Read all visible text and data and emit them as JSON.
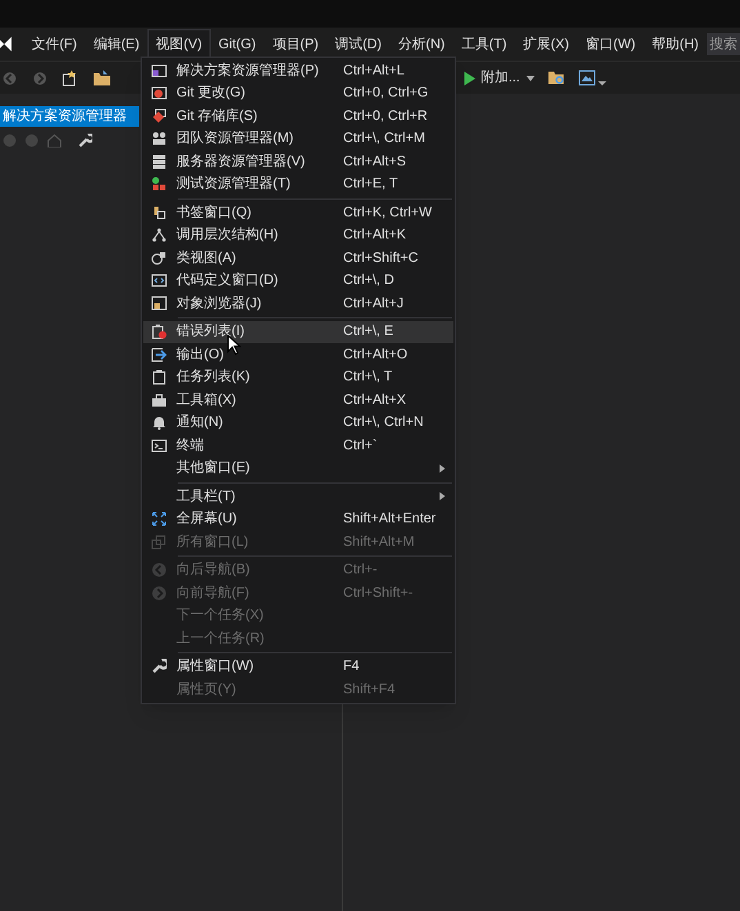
{
  "menu_bar": {
    "items": [
      {
        "label": "文件(F)",
        "selected": false
      },
      {
        "label": "编辑(E)",
        "selected": false
      },
      {
        "label": "视图(V)",
        "selected": true
      },
      {
        "label": "Git(G)",
        "selected": false
      },
      {
        "label": "项目(P)",
        "selected": false
      },
      {
        "label": "调试(D)",
        "selected": false
      },
      {
        "label": "分析(N)",
        "selected": false
      },
      {
        "label": "工具(T)",
        "selected": false
      },
      {
        "label": "扩展(X)",
        "selected": false
      },
      {
        "label": "窗口(W)",
        "selected": false
      },
      {
        "label": "帮助(H)",
        "selected": false
      }
    ],
    "search": {
      "placeholder": "搜索"
    }
  },
  "toolbar": {
    "attach_button": "附加..."
  },
  "side_panel": {
    "title": "解决方案资源管理器"
  },
  "view_menu": [
    {
      "kind": "item",
      "label": "解决方案资源管理器(P)",
      "shortcut": "Ctrl+Alt+L",
      "disabled": false,
      "selected": false
    },
    {
      "kind": "item",
      "label": "Git 更改(G)",
      "shortcut": "Ctrl+0, Ctrl+G",
      "disabled": false,
      "selected": false
    },
    {
      "kind": "item",
      "label": "Git 存储库(S)",
      "shortcut": "Ctrl+0, Ctrl+R",
      "disabled": false,
      "selected": false
    },
    {
      "kind": "item",
      "label": "团队资源管理器(M)",
      "shortcut": "Ctrl+\\, Ctrl+M",
      "disabled": false,
      "selected": false
    },
    {
      "kind": "item",
      "label": "服务器资源管理器(V)",
      "shortcut": "Ctrl+Alt+S",
      "disabled": false,
      "selected": false
    },
    {
      "kind": "item",
      "label": "测试资源管理器(T)",
      "shortcut": "Ctrl+E, T",
      "disabled": false,
      "selected": false
    },
    {
      "kind": "separator"
    },
    {
      "kind": "item",
      "label": "书签窗口(Q)",
      "shortcut": "Ctrl+K, Ctrl+W",
      "disabled": false,
      "selected": false
    },
    {
      "kind": "item",
      "label": "调用层次结构(H)",
      "shortcut": "Ctrl+Alt+K",
      "disabled": false,
      "selected": false
    },
    {
      "kind": "item",
      "label": "类视图(A)",
      "shortcut": "Ctrl+Shift+C",
      "disabled": false,
      "selected": false
    },
    {
      "kind": "item",
      "label": "代码定义窗口(D)",
      "shortcut": "Ctrl+\\, D",
      "disabled": false,
      "selected": false
    },
    {
      "kind": "item",
      "label": "对象浏览器(J)",
      "shortcut": "Ctrl+Alt+J",
      "disabled": false,
      "selected": false
    },
    {
      "kind": "separator"
    },
    {
      "kind": "item",
      "label": "错误列表(I)",
      "shortcut": "Ctrl+\\, E",
      "disabled": false,
      "selected": true
    },
    {
      "kind": "item",
      "label": "输出(O)",
      "shortcut": "Ctrl+Alt+O",
      "disabled": false,
      "selected": false
    },
    {
      "kind": "item",
      "label": "任务列表(K)",
      "shortcut": "Ctrl+\\, T",
      "disabled": false,
      "selected": false
    },
    {
      "kind": "item",
      "label": "工具箱(X)",
      "shortcut": "Ctrl+Alt+X",
      "disabled": false,
      "selected": false
    },
    {
      "kind": "item",
      "label": "通知(N)",
      "shortcut": "Ctrl+\\, Ctrl+N",
      "disabled": false,
      "selected": false
    },
    {
      "kind": "item",
      "label": "终端",
      "shortcut": "Ctrl+`",
      "disabled": false,
      "selected": false
    },
    {
      "kind": "submenu",
      "label": "其他窗口(E)",
      "disabled": false,
      "selected": false
    },
    {
      "kind": "separator"
    },
    {
      "kind": "submenu",
      "label": "工具栏(T)",
      "disabled": false,
      "selected": false
    },
    {
      "kind": "item",
      "label": "全屏幕(U)",
      "shortcut": "Shift+Alt+Enter",
      "disabled": false,
      "selected": false
    },
    {
      "kind": "item",
      "label": "所有窗口(L)",
      "shortcut": "Shift+Alt+M",
      "disabled": true,
      "selected": false
    },
    {
      "kind": "separator"
    },
    {
      "kind": "item",
      "label": "向后导航(B)",
      "shortcut": "Ctrl+-",
      "disabled": true,
      "selected": false
    },
    {
      "kind": "item",
      "label": "向前导航(F)",
      "shortcut": "Ctrl+Shift+-",
      "disabled": true,
      "selected": false
    },
    {
      "kind": "item",
      "label": "下一个任务(X)",
      "disabled": true,
      "selected": false
    },
    {
      "kind": "item",
      "label": "上一个任务(R)",
      "disabled": true,
      "selected": false
    },
    {
      "kind": "separator"
    },
    {
      "kind": "item",
      "label": "属性窗口(W)",
      "shortcut": "F4",
      "disabled": false,
      "selected": false
    },
    {
      "kind": "item",
      "label": "属性页(Y)",
      "shortcut": "Shift+F4",
      "disabled": true,
      "selected": false
    }
  ]
}
